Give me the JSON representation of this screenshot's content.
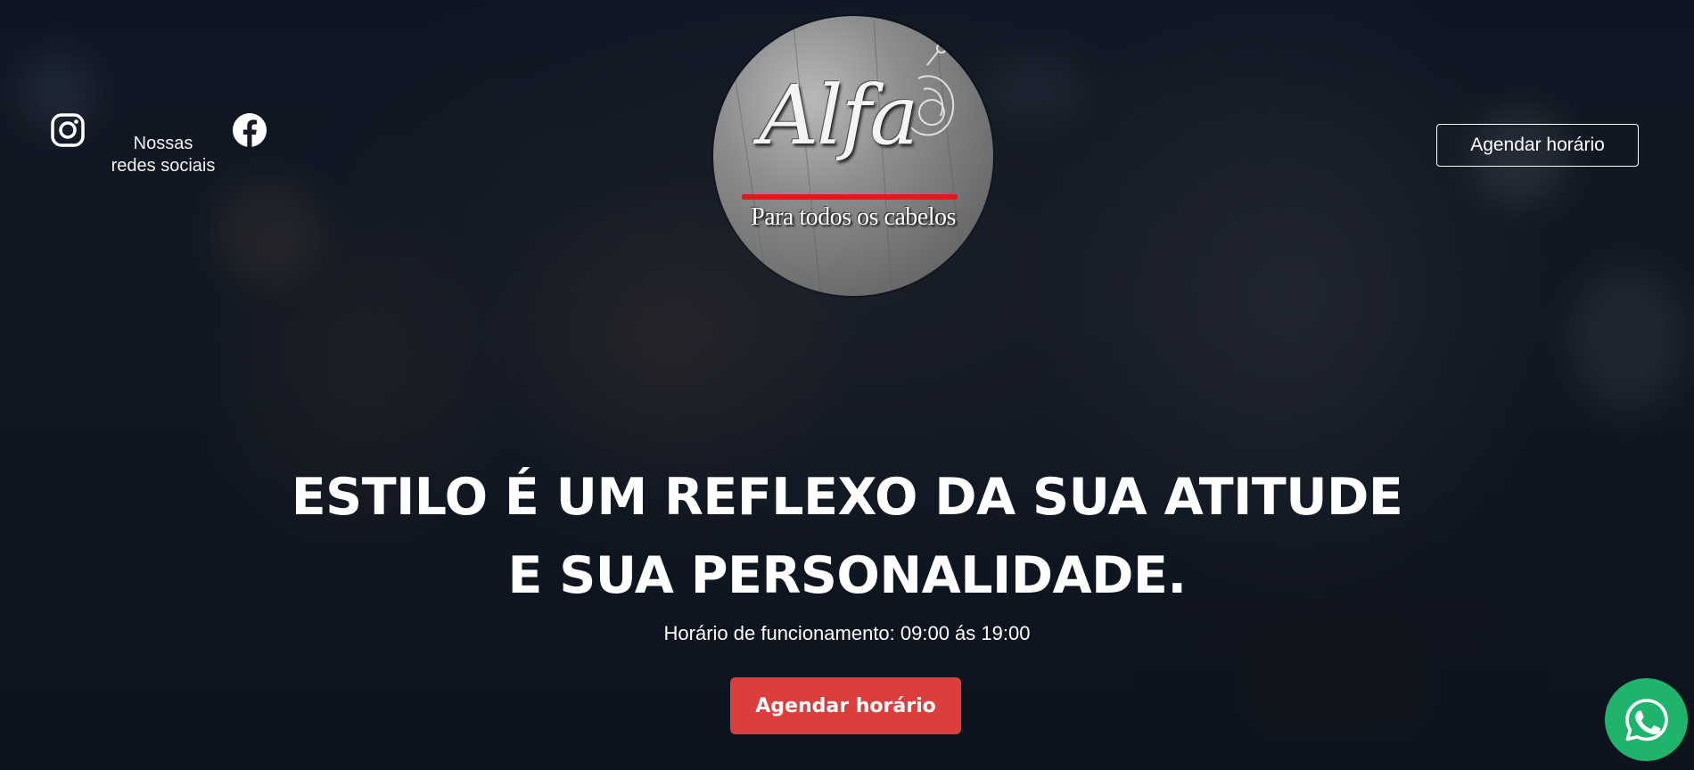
{
  "header": {
    "social_label": "Nossas\nredes sociais",
    "social_icons": [
      "instagram-icon",
      "facebook-icon"
    ],
    "cta_outline_label": "Agendar horário"
  },
  "logo": {
    "script_text": "Alfa",
    "tagline": "Para todos os cabelos",
    "accent_color": "#e01a1a"
  },
  "hero": {
    "headline_line1": "ESTILO É UM REFLEXO DA SUA ATITUDE",
    "headline_line2": "E SUA PERSONALIDADE.",
    "hours": "Horário de funcionamento: 09:00 ás 19:00",
    "cta_primary_label": "Agendar horário",
    "cta_primary_color": "#dc3d3d"
  },
  "floating": {
    "icon": "whatsapp-icon",
    "color": "#1fb46e"
  }
}
